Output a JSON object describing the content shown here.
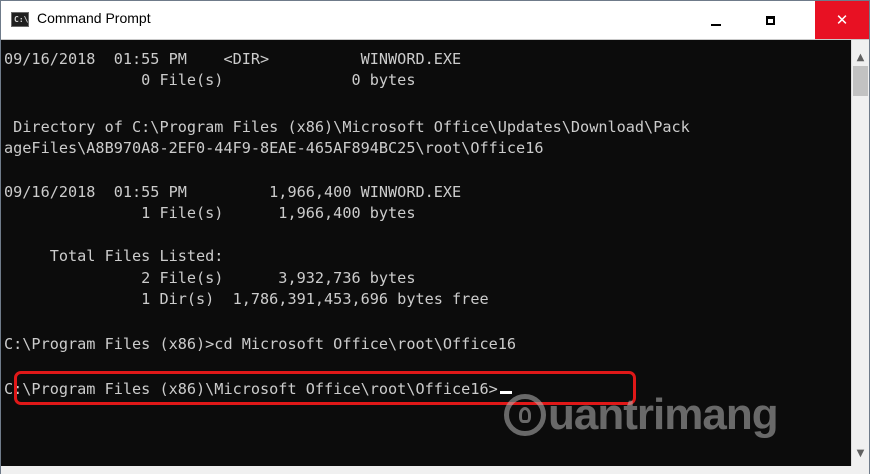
{
  "window": {
    "title": "Command Prompt",
    "app_icon_text": "C:\\",
    "controls": {
      "minimize": "minimize",
      "maximize": "maximize",
      "close": "✕"
    }
  },
  "console": {
    "lines": [
      "09/16/2018  01:55 PM    <DIR>          WINWORD.EXE",
      "               0 File(s)              0 bytes",
      "",
      " Directory of C:\\Program Files (x86)\\Microsoft Office\\Updates\\Download\\Pack",
      "ageFiles\\A8B970A8-2EF0-44F9-8EAE-465AF894BC25\\root\\Office16",
      "",
      "09/16/2018  01:55 PM         1,966,400 WINWORD.EXE",
      "               1 File(s)      1,966,400 bytes",
      "",
      "     Total Files Listed:",
      "               2 File(s)      3,932,736 bytes",
      "               1 Dir(s)  1,786,391,453,696 bytes free",
      "",
      "C:\\Program Files (x86)>cd Microsoft Office\\root\\Office16",
      "",
      "C:\\Program Files (x86)\\Microsoft Office\\root\\Office16>"
    ],
    "highlighted_line_index": 15
  },
  "watermark": {
    "text": "uantrimang"
  }
}
